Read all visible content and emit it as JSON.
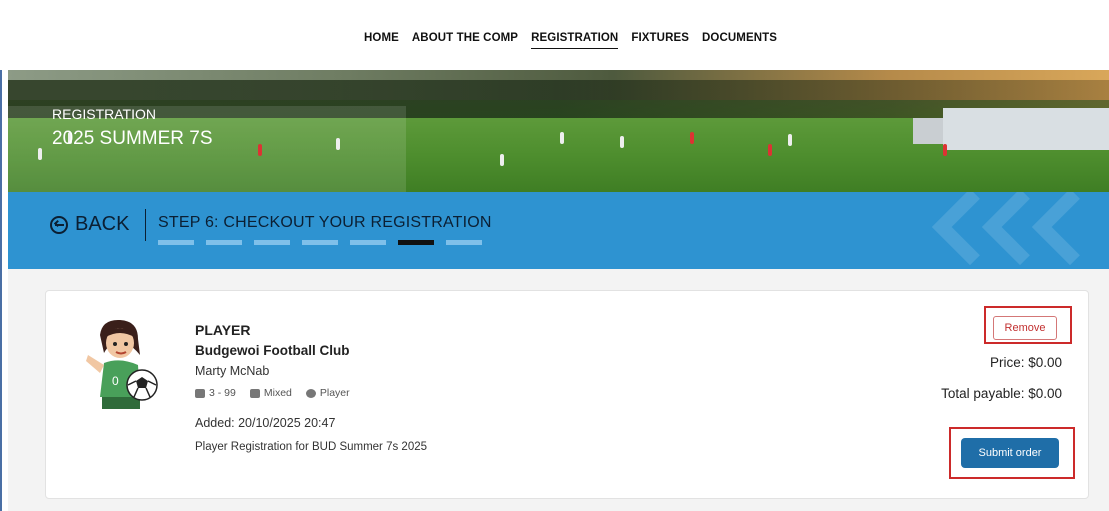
{
  "nav": {
    "items": [
      {
        "label": "HOME"
      },
      {
        "label": "ABOUT THE COMP"
      },
      {
        "label": "REGISTRATION",
        "active": true
      },
      {
        "label": "FIXTURES"
      },
      {
        "label": "DOCUMENTS"
      }
    ]
  },
  "hero": {
    "kicker": "REGISTRATION",
    "title": "2025 SUMMER 7S"
  },
  "stepbar": {
    "back_label": "BACK",
    "title": "STEP 6: CHECKOUT YOUR REGISTRATION",
    "total_steps": 7,
    "current_step": 6,
    "color": "#2e93d1"
  },
  "order": {
    "role": "PLAYER",
    "club": "Budgewoi Football Club",
    "person": "Marty McNab",
    "age_range": "3 - 99",
    "gender": "Mixed",
    "type": "Player",
    "added": "Added: 20/10/2025 20:47",
    "description": "Player Registration for BUD Summer 7s 2025",
    "remove_label": "Remove",
    "price": "Price: $0.00",
    "total": "Total payable: $0.00",
    "submit_label": "Submit order"
  },
  "colors": {
    "accent": "#2e93d1",
    "submit": "#1f6ea8",
    "highlight": "#cc2a2a"
  }
}
